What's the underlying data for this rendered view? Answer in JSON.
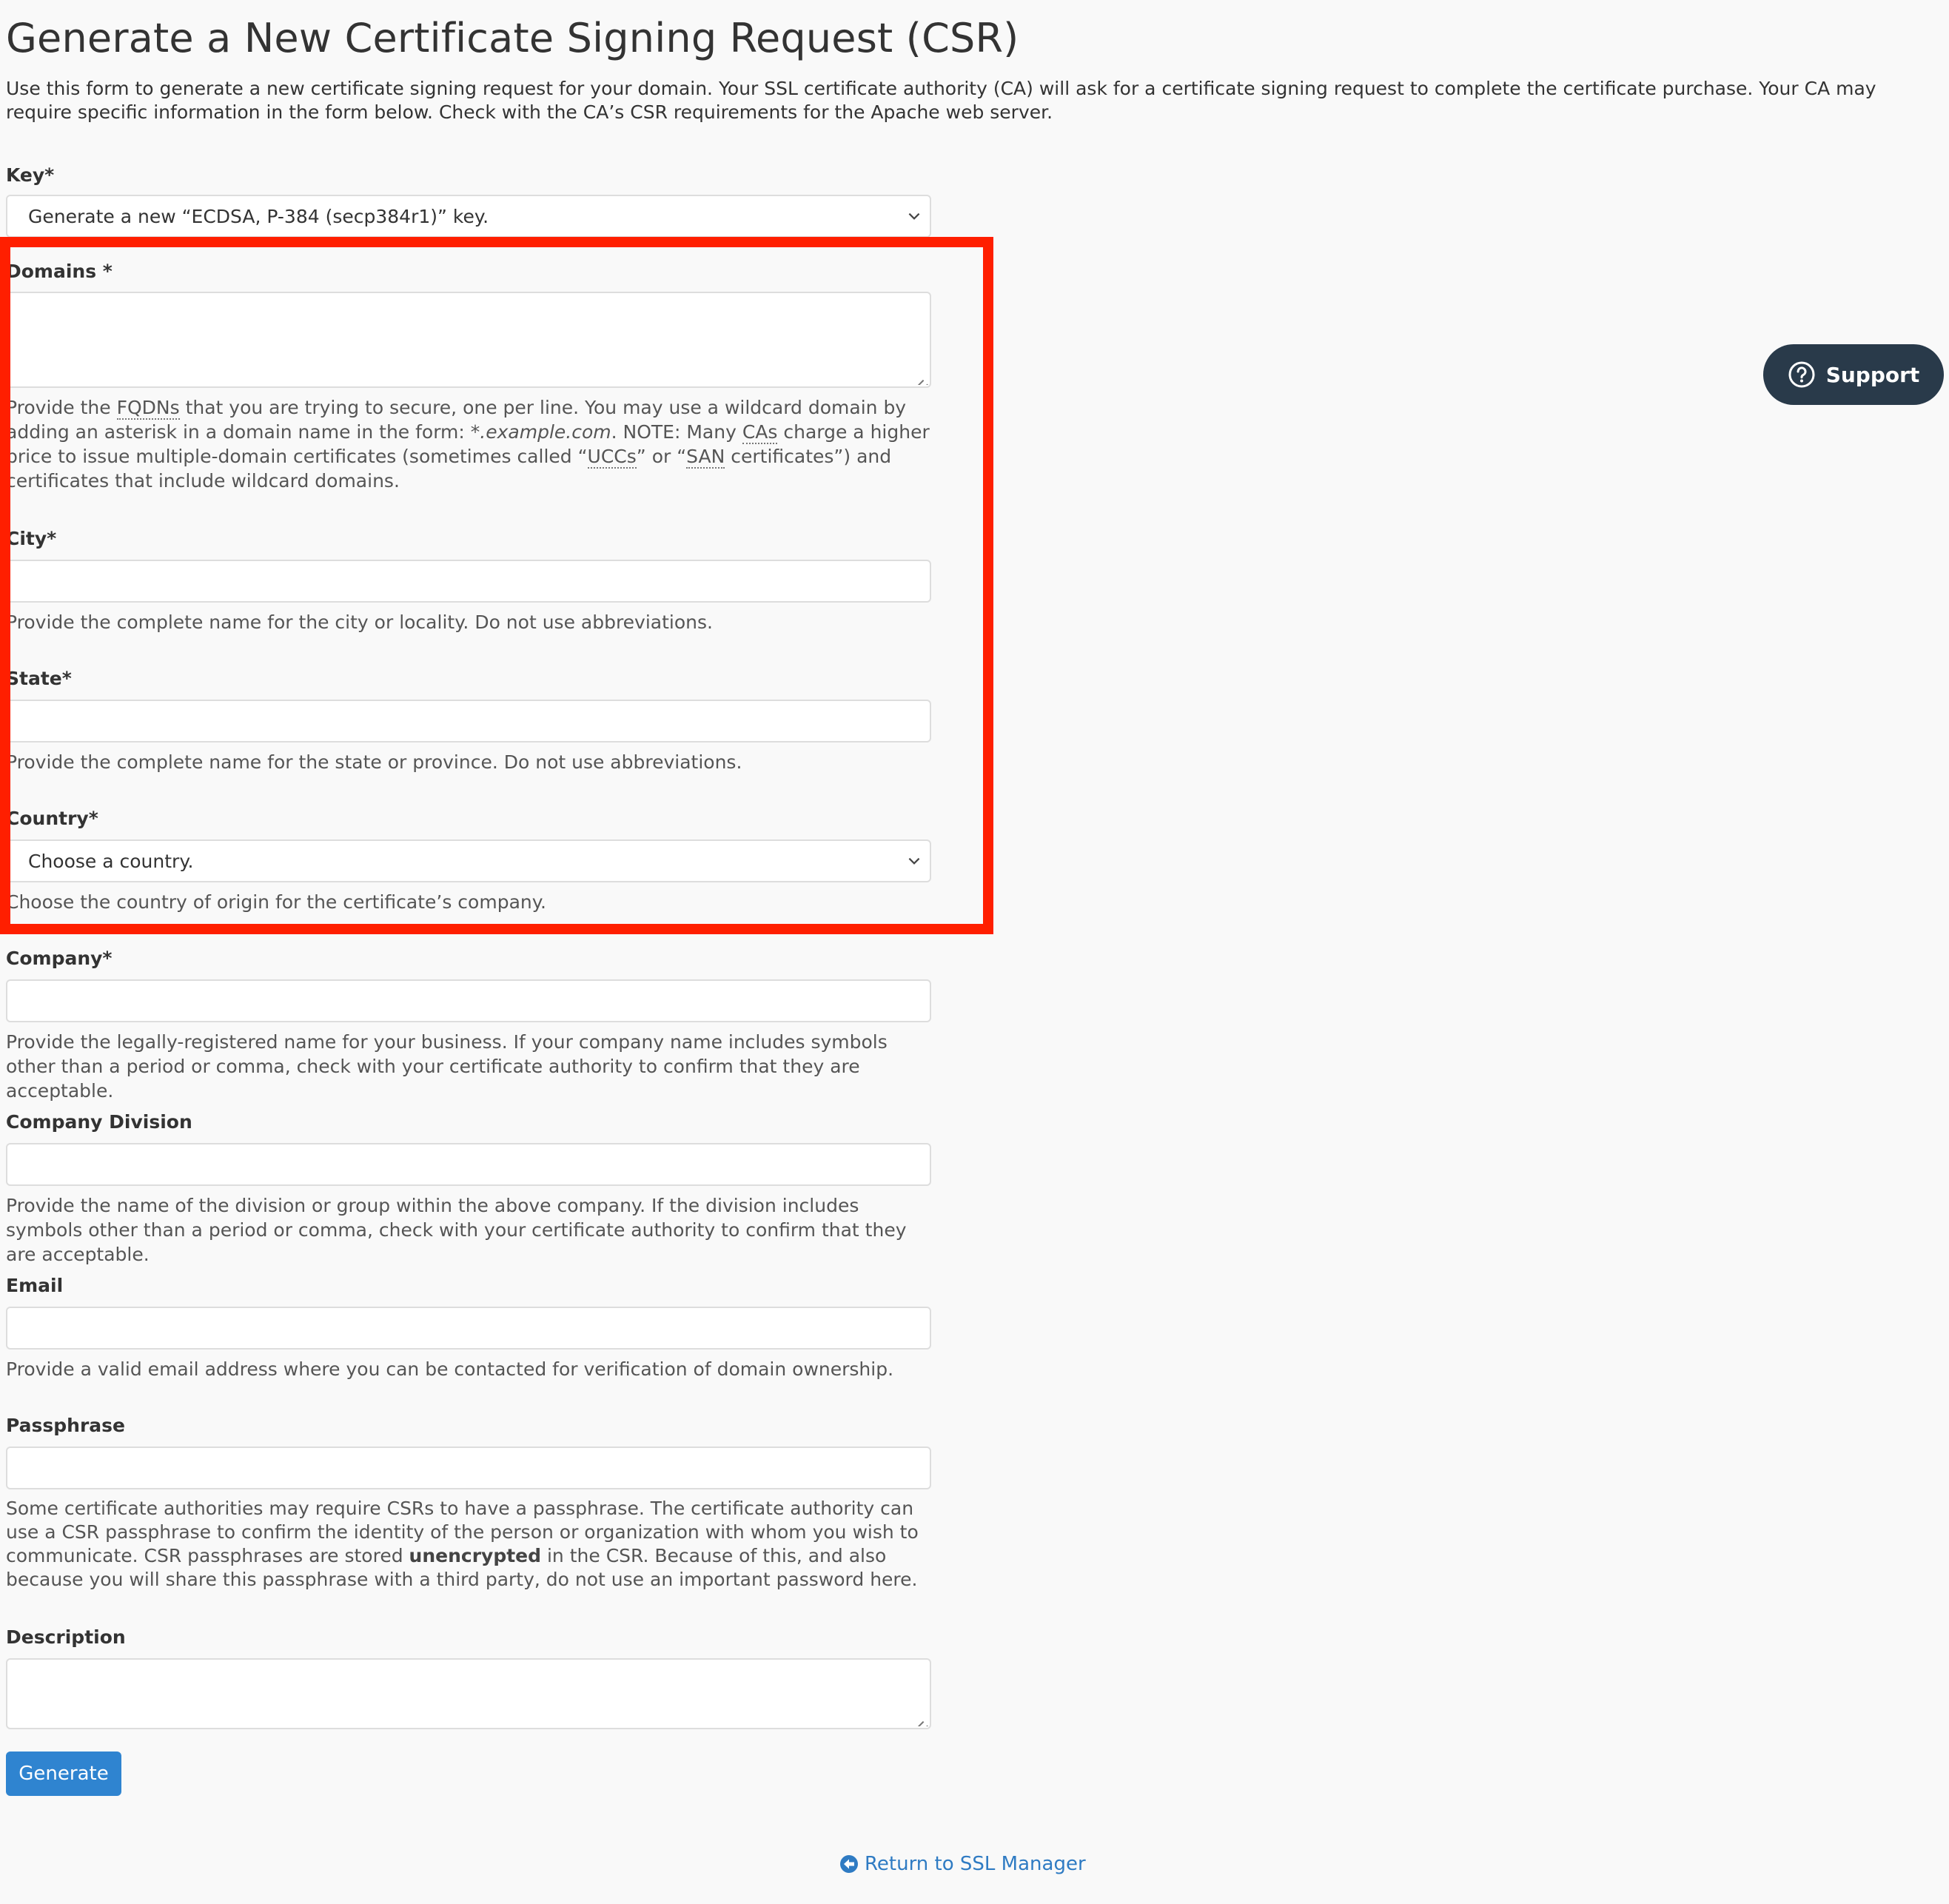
{
  "header": {
    "title": "Generate a New Certificate Signing Request (CSR)",
    "intro": "Use this form to generate a new certificate signing request for your domain. Your SSL certificate authority (CA) will ask for a certificate signing request to complete the certificate purchase. Your CA may require specific information in the form below. Check with the CA’s CSR requirements for the Apache web server."
  },
  "form": {
    "key": {
      "label": "Key*",
      "value": "Generate a new “ECDSA, P-384 (secp384r1)” key."
    },
    "domains": {
      "label": "Domains *",
      "value": "",
      "help": {
        "p1": "Provide the ",
        "fqdns": "FQDNs",
        "p2": " that you are trying to secure, one per line. You may use a wildcard domain by adding an asterisk in a domain name in the form: ",
        "example": "*.example.com",
        "p3": ". NOTE: Many ",
        "cas": "CAs",
        "p4": " charge a higher price to issue multiple-domain certificates (sometimes called “",
        "uccs": "UCCs",
        "p5": "” or “",
        "san": "SAN",
        "p6": " certificates”) and certificates that include wildcard domains."
      }
    },
    "city": {
      "label": "City*",
      "value": "",
      "help": "Provide the complete name for the city or locality. Do not use abbreviations."
    },
    "state": {
      "label": "State*",
      "value": "",
      "help": "Provide the complete name for the state or province. Do not use abbreviations."
    },
    "country": {
      "label": "Country*",
      "value": "Choose a country.",
      "help": "Choose the country of origin for the certificate’s company."
    },
    "company": {
      "label": "Company*",
      "value": "",
      "help": "Provide the legally-registered name for your business. If your company name includes symbols other than a period or comma, check with your certificate authority to confirm that they are acceptable."
    },
    "company_division": {
      "label": "Company Division",
      "value": "",
      "help": "Provide the name of the division or group within the above company. If the division includes symbols other than a period or comma, check with your certificate authority to confirm that they are acceptable."
    },
    "email": {
      "label": "Email",
      "value": "",
      "help": "Provide a valid email address where you can be contacted for verification of domain ownership."
    },
    "passphrase": {
      "label": "Passphrase",
      "value": "",
      "help_p1": "Some certificate authorities may require CSRs to have a passphrase. The certificate authority can use a CSR passphrase to confirm the identity of the person or organization with whom you wish to communicate. CSR passphrases are stored ",
      "help_bold": "unencrypted",
      "help_p2": " in the CSR. Because of this, and also because you will share this passphrase with a third party, do not use an important password here."
    },
    "description": {
      "label": "Description",
      "value": ""
    },
    "generate_label": "Generate"
  },
  "support": {
    "label": "Support",
    "icon": "question-circle-icon"
  },
  "footer": {
    "return_label": "Return to SSL Manager",
    "icon": "arrow-left-circle-icon"
  },
  "colors": {
    "highlight": "#ff1f00",
    "primary": "#2f84d0",
    "support_bg": "#293a4a",
    "link": "#2f7bc3"
  }
}
